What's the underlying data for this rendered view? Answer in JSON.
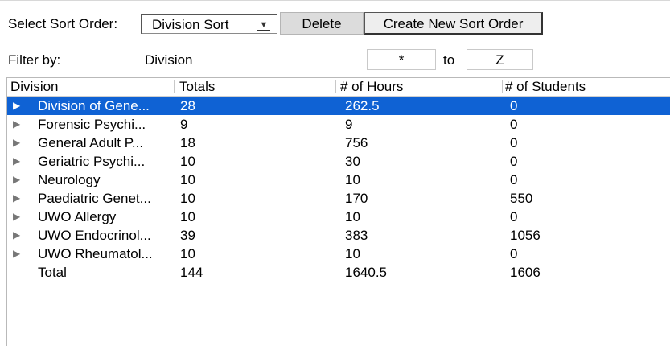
{
  "sort": {
    "label": "Select Sort Order:",
    "selected": "Division Sort",
    "delete_label": "Delete",
    "create_label": "Create New Sort Order"
  },
  "filter": {
    "label": "Filter by:",
    "field": "Division",
    "from": "*",
    "to_label": "to",
    "to": "Z"
  },
  "table": {
    "columns": [
      "Division",
      "Totals",
      "# of Hours",
      "# of Students"
    ],
    "rows": [
      {
        "name": "Division of Gene...",
        "totals": "28",
        "hours": "262.5",
        "students": "0",
        "selected": true
      },
      {
        "name": "Forensic Psychi...",
        "totals": "9",
        "hours": "9",
        "students": "0"
      },
      {
        "name": "General Adult P...",
        "totals": "18",
        "hours": "756",
        "students": "0"
      },
      {
        "name": "Geriatric Psychi...",
        "totals": "10",
        "hours": "30",
        "students": "0"
      },
      {
        "name": "Neurology",
        "totals": "10",
        "hours": "10",
        "students": "0"
      },
      {
        "name": "Paediatric Genet...",
        "totals": "10",
        "hours": "170",
        "students": "550"
      },
      {
        "name": "UWO Allergy",
        "totals": "10",
        "hours": "10",
        "students": "0"
      },
      {
        "name": "UWO Endocrinol...",
        "totals": "39",
        "hours": "383",
        "students": "1056"
      },
      {
        "name": "UWO Rheumatol...",
        "totals": "10",
        "hours": "10",
        "students": "0"
      }
    ],
    "total": {
      "name": "Total",
      "totals": "144",
      "hours": "1640.5",
      "students": "1606"
    }
  },
  "colors": {
    "selection": "#0f62d4"
  }
}
